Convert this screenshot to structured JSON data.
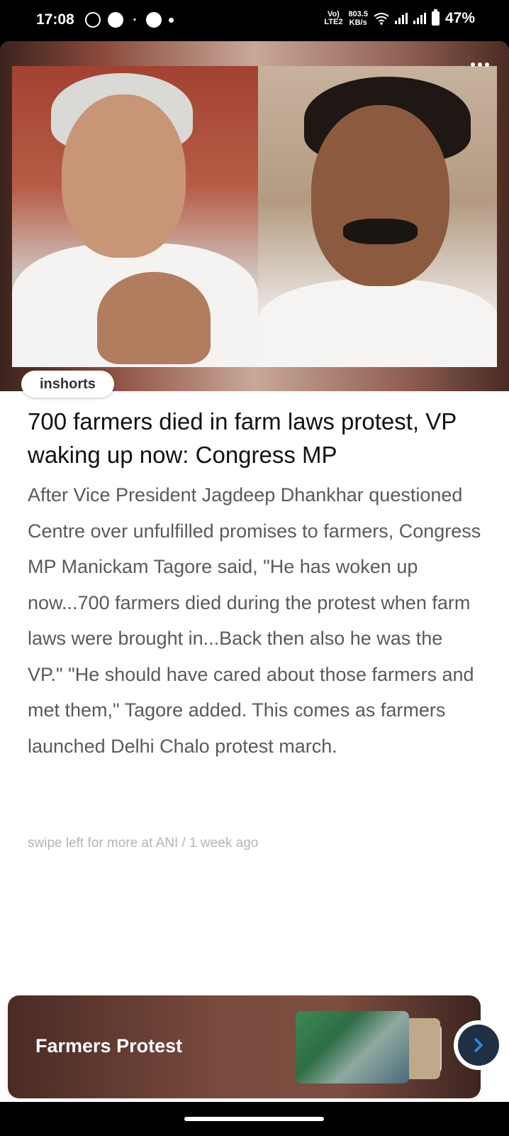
{
  "status_bar": {
    "time": "17:08",
    "network_top": "Vo)",
    "network_bottom": "LTE2",
    "speed_value": "803.5",
    "speed_unit": "KB/s",
    "battery": "47%"
  },
  "article": {
    "brand": "inshorts",
    "headline": "700 farmers died in farm laws protest, VP waking up now: Congress MP",
    "body": "After Vice President Jagdeep Dhankhar questioned Centre over unfulfilled promises to farmers, Congress MP Manickam Tagore said, \"He has woken up now...700 farmers died during the protest when farm laws were brought in...Back then also he was the VP.\" \"He should have cared about those farmers and met them,\" Tagore added. This comes as farmers launched Delhi Chalo protest march.",
    "source": "swipe left for more at ANI / 1 week ago"
  },
  "topic_card": {
    "title": "Farmers Protest"
  },
  "icons": {
    "more": "more-dots-icon",
    "next": "chevron-right-icon"
  },
  "colors": {
    "accent": "#2f7de1",
    "next_button_bg": "#1f2f44"
  }
}
